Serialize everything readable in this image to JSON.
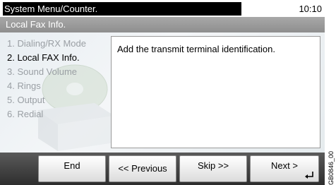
{
  "header": {
    "title": "System Menu/Counter.",
    "time": "10:10"
  },
  "subheader": {
    "title": "Local Fax Info."
  },
  "menu": {
    "items": [
      {
        "label": "1. Dialing/RX Mode",
        "active": false
      },
      {
        "label": "2. Local FAX Info.",
        "active": true
      },
      {
        "label": "3. Sound Volume",
        "active": false
      },
      {
        "label": "4. Rings",
        "active": false
      },
      {
        "label": "5. Output",
        "active": false
      },
      {
        "label": "6. Redial",
        "active": false
      }
    ]
  },
  "content": {
    "text": "Add the transmit terminal identification."
  },
  "buttons": {
    "end": "End",
    "previous": "<< Previous",
    "skip": "Skip >>",
    "next": "Next >"
  },
  "icons": {
    "enter": "enter-return-icon",
    "illustration": "cd-box-illustration"
  },
  "figure_code": "GB0846_00",
  "colors": {
    "title_bg": "#000000",
    "subheader_bg": "#999999",
    "button_bar_bg": "#3a3a3a",
    "menu_inactive": "#9a9fa4"
  }
}
